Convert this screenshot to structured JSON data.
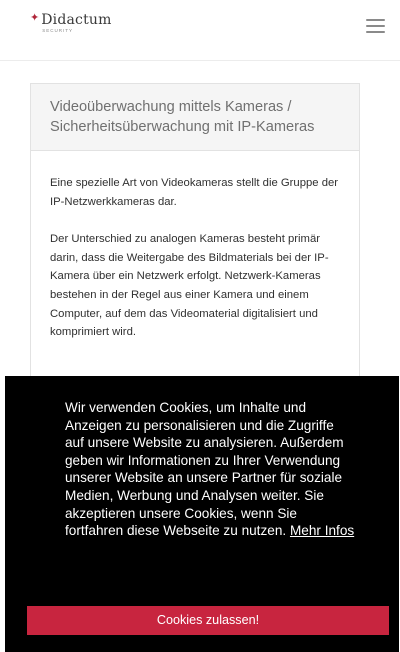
{
  "header": {
    "logo_name": "Didactum",
    "logo_tagline": "SECURITY",
    "logo_mark_icon": "diamond-mark",
    "menu_icon": "hamburger-menu-icon"
  },
  "article": {
    "title": "Videoüberwachung mittels Kameras / Sicherheitsüberwachung mit IP-Kameras",
    "paragraphs": [
      "Eine spezielle Art von Videokameras stellt die Gruppe der IP-Netzwerkkameras dar.",
      "Der Unterschied zu analogen Kameras besteht primär darin, dass die Weitergabe des Bildmaterials bei der IP-Kamera über ein Netzwerk erfolgt. Netzwerk-Kameras bestehen in der Regel aus einer Kamera und einem Computer, auf dem das Videomaterial digitalisiert und komprimiert wird."
    ]
  },
  "cookie_banner": {
    "message": "Wir verwenden Cookies, um Inhalte und Anzeigen zu personalisieren und die Zugriffe auf unsere Website zu analysieren. Außerdem geben wir Informationen zu Ihrer Verwendung unserer Website an unsere Partner für soziale Medien, Werbung und Analysen weiter. Sie akzeptieren unsere Cookies, wenn Sie fortfahren diese Webseite zu nutzen.",
    "more_info_label": "Mehr Infos",
    "accept_label": "Cookies zulassen!"
  },
  "colors": {
    "accent": "#c8253f",
    "banner_background": "#000000",
    "card_header_background": "#f5f5f5"
  }
}
